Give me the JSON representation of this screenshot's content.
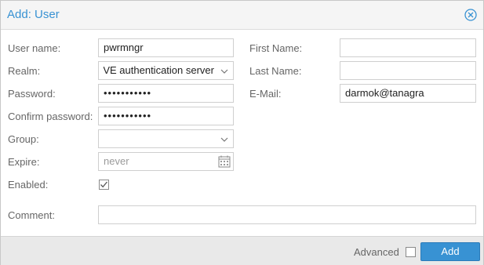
{
  "dialog": {
    "title": "Add: User",
    "close_icon": "close-circle-icon"
  },
  "form": {
    "username_label": "User name:",
    "username_value": "pwrmngr",
    "realm_label": "Realm:",
    "realm_value": "Proxmox VE authentication server",
    "password_label": "Password:",
    "password_value": "•••••••••••",
    "confirm_label": "Confirm password:",
    "confirm_value": "•••••••••••",
    "group_label": "Group:",
    "group_value": "",
    "expire_label": "Expire:",
    "expire_placeholder": "never",
    "enabled_label": "Enabled:",
    "enabled_checked": true,
    "comment_label": "Comment:",
    "comment_value": "",
    "firstname_label": "First Name:",
    "firstname_value": "",
    "lastname_label": "Last Name:",
    "lastname_value": "",
    "email_label": "E-Mail:",
    "email_value": "darmok@tanagra"
  },
  "footer": {
    "advanced_label": "Advanced",
    "advanced_checked": false,
    "add_label": "Add"
  },
  "colors": {
    "accent": "#3892d3",
    "title": "#3892d3"
  }
}
